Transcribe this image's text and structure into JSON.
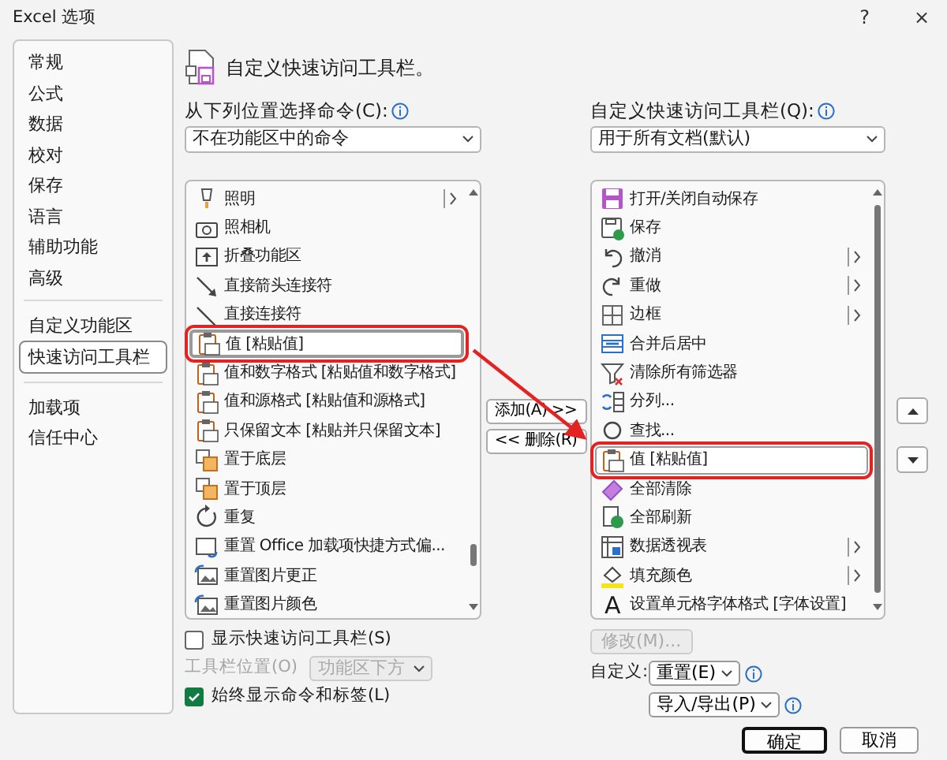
{
  "window": {
    "title": "Excel 选项",
    "help": "?",
    "close": "×"
  },
  "sidebar": {
    "groups": [
      [
        {
          "label": "常规",
          "selected": false
        },
        {
          "label": "公式",
          "selected": false
        },
        {
          "label": "数据",
          "selected": false
        },
        {
          "label": "校对",
          "selected": false
        },
        {
          "label": "保存",
          "selected": false
        },
        {
          "label": "语言",
          "selected": false
        },
        {
          "label": "辅助功能",
          "selected": false
        },
        {
          "label": "高级",
          "selected": false
        }
      ],
      [
        {
          "label": "自定义功能区",
          "selected": false
        },
        {
          "label": "快速访问工具栏",
          "selected": true
        }
      ],
      [
        {
          "label": "加载项",
          "selected": false
        },
        {
          "label": "信任中心",
          "selected": false
        }
      ]
    ]
  },
  "header": {
    "title": "自定义快速访问工具栏。"
  },
  "source": {
    "label": "从下列位置选择命令(C):",
    "value": "不在功能区中的命令",
    "items": [
      {
        "label": "照明",
        "kind": "lamp",
        "submenu": true,
        "selected": false,
        "highlighted": false
      },
      {
        "label": "照相机",
        "kind": "camera",
        "submenu": false,
        "selected": false,
        "highlighted": false
      },
      {
        "label": "折叠功能区",
        "kind": "collapse",
        "submenu": false,
        "selected": false,
        "highlighted": false
      },
      {
        "label": "直接箭头连接符",
        "kind": "arrowline",
        "submenu": false,
        "selected": false,
        "highlighted": false
      },
      {
        "label": "直接连接符",
        "kind": "line",
        "submenu": false,
        "selected": false,
        "highlighted": false
      },
      {
        "label": "值 [粘贴值]",
        "kind": "paste",
        "submenu": false,
        "selected": true,
        "highlighted": true
      },
      {
        "label": "值和数字格式 [粘贴值和数字格式]",
        "kind": "paste",
        "submenu": false,
        "selected": false,
        "highlighted": false
      },
      {
        "label": "值和源格式 [粘贴值和源格式]",
        "kind": "paste",
        "submenu": false,
        "selected": false,
        "highlighted": false
      },
      {
        "label": "只保留文本 [粘贴并只保留文本]",
        "kind": "paste",
        "submenu": false,
        "selected": false,
        "highlighted": false
      },
      {
        "label": "置于底层",
        "kind": "layers",
        "submenu": false,
        "selected": false,
        "highlighted": false
      },
      {
        "label": "置于顶层",
        "kind": "layers",
        "submenu": false,
        "selected": false,
        "highlighted": false
      },
      {
        "label": "重复",
        "kind": "repeat",
        "submenu": false,
        "selected": false,
        "highlighted": false
      },
      {
        "label": "重置 Office 加载项快捷方式偏...",
        "kind": "addin",
        "submenu": false,
        "selected": false,
        "highlighted": false
      },
      {
        "label": "重置图片更正",
        "kind": "picture",
        "submenu": false,
        "selected": false,
        "highlighted": false
      },
      {
        "label": "重置图片颜色",
        "kind": "picture",
        "submenu": false,
        "selected": false,
        "highlighted": false
      }
    ]
  },
  "add_button": "添加(A) >>",
  "remove_button": "<< 删除(R)",
  "toolbar": {
    "label": "自定义快速访问工具栏(Q):",
    "value": "用于所有文档(默认)",
    "items": [
      {
        "label": "打开/关闭自动保存",
        "kind": "autosave",
        "submenu": false,
        "selected": false,
        "highlighted": false
      },
      {
        "label": "保存",
        "kind": "save",
        "submenu": false,
        "selected": false,
        "highlighted": false
      },
      {
        "label": "撤消",
        "kind": "undo",
        "submenu": true,
        "selected": false,
        "highlighted": false
      },
      {
        "label": "重做",
        "kind": "redo",
        "submenu": true,
        "selected": false,
        "highlighted": false
      },
      {
        "label": "边框",
        "kind": "border",
        "submenu": true,
        "selected": false,
        "highlighted": false
      },
      {
        "label": "合并后居中",
        "kind": "merge",
        "submenu": false,
        "selected": false,
        "highlighted": false
      },
      {
        "label": "清除所有筛选器",
        "kind": "filter",
        "submenu": false,
        "selected": false,
        "highlighted": false
      },
      {
        "label": "分列...",
        "kind": "columns",
        "submenu": false,
        "selected": false,
        "highlighted": false
      },
      {
        "label": "查找...",
        "kind": "find",
        "submenu": false,
        "selected": false,
        "highlighted": false
      },
      {
        "label": "值 [粘贴值]",
        "kind": "paste",
        "submenu": false,
        "selected": false,
        "highlighted": true
      },
      {
        "label": "全部清除",
        "kind": "eraser",
        "submenu": false,
        "selected": false,
        "highlighted": false
      },
      {
        "label": "全部刷新",
        "kind": "refresh",
        "submenu": false,
        "selected": false,
        "highlighted": false
      },
      {
        "label": "数据透视表",
        "kind": "pivot",
        "submenu": true,
        "selected": false,
        "highlighted": false
      },
      {
        "label": "填充颜色",
        "kind": "fill",
        "submenu": true,
        "selected": false,
        "highlighted": false
      },
      {
        "label": "设置单元格字体格式 [字体设置]",
        "kind": "glyph",
        "glyph": "A",
        "submenu": false,
        "selected": false,
        "highlighted": false
      }
    ]
  },
  "annotation_arrow": true,
  "options": [
    {
      "label": "显示快速访问工具栏(S)",
      "checked": false
    }
  ],
  "position": {
    "label": "工具栏位置(O)",
    "value": "功能区下方",
    "disabled": true
  },
  "options_after": [
    {
      "label": "始终显示命令和标签(L)",
      "checked": true
    }
  ],
  "modify_button": {
    "label": "修改(M)...",
    "disabled": true
  },
  "customize": {
    "label": "自定义:",
    "buttons": [
      "重置(E)",
      "导入/导出(P)"
    ]
  },
  "footer": [
    {
      "label": "确定",
      "default": true
    },
    {
      "label": "取消",
      "default": false
    }
  ]
}
